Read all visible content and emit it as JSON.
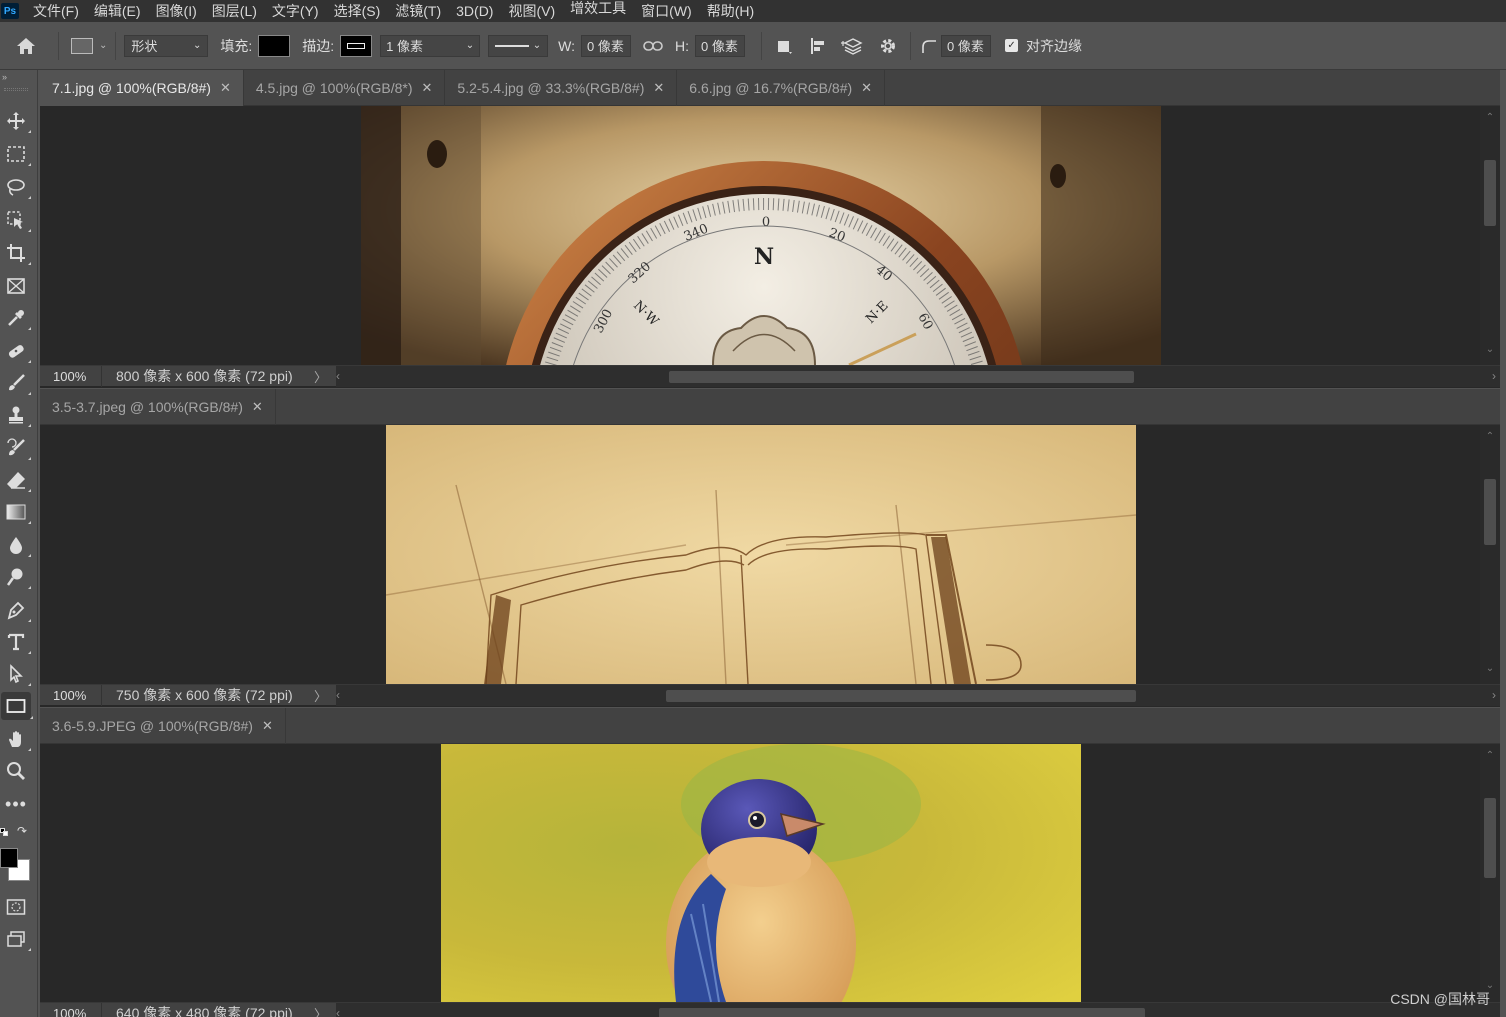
{
  "app": {
    "logo": "Ps"
  },
  "menu": [
    "文件(F)",
    "编辑(E)",
    "图像(I)",
    "图层(L)",
    "文字(Y)",
    "选择(S)",
    "滤镜(T)",
    "3D(D)",
    "视图(V)",
    "增效工具",
    "窗口(W)",
    "帮助(H)"
  ],
  "options": {
    "mode": "形状",
    "fill_label": "填充:",
    "stroke_label": "描边:",
    "stroke_width": "1 像素",
    "w_label": "W:",
    "w_value": "0 像素",
    "h_label": "H:",
    "h_value": "0 像素",
    "radius_value": "0 像素",
    "align_edges_label": "对齐边缘",
    "align_edges_checked": true
  },
  "tools": [
    "move-tool-icon",
    "marquee-tool-icon",
    "lasso-tool-icon",
    "object-select-tool-icon",
    "crop-tool-icon",
    "frame-tool-icon",
    "eyedropper-tool-icon",
    "healing-brush-icon",
    "brush-tool-icon",
    "stamp-tool-icon",
    "history-brush-icon",
    "eraser-tool-icon",
    "gradient-tool-icon",
    "blur-tool-icon",
    "dodge-tool-icon",
    "pen-tool-icon",
    "type-tool-icon",
    "path-select-tool-icon",
    "rectangle-tool-icon",
    "hand-tool-icon",
    "zoom-tool-icon",
    "more-tools-icon"
  ],
  "doc1": {
    "tabs": [
      {
        "label": "7.1.jpg @ 100%(RGB/8#)",
        "active": true
      },
      {
        "label": "4.5.jpg @ 100%(RGB/8*)",
        "active": false
      },
      {
        "label": "5.2-5.4.jpg @ 33.3%(RGB/8#)",
        "active": false
      },
      {
        "label": "6.6.jpg @ 16.7%(RGB/8#)",
        "active": false
      }
    ],
    "zoom": "100%",
    "info": "800 像素 x 600 像素 (72 ppi)",
    "compass_marks": [
      "0",
      "20",
      "340",
      "40",
      "320",
      "N",
      "N·W",
      "N·E",
      "300",
      "60"
    ]
  },
  "doc2": {
    "tabs": [
      {
        "label": "3.5-3.7.jpeg @ 100%(RGB/8#)",
        "active": true
      }
    ],
    "zoom": "100%",
    "info": "750 像素 x 600 像素 (72 ppi)"
  },
  "doc3": {
    "tabs": [
      {
        "label": "3.6-5.9.JPEG @ 100%(RGB/8#)",
        "active": true
      }
    ],
    "zoom": "100%",
    "info": "640 像素 x 480 像素 (72 ppi)"
  },
  "watermark": "CSDN @国林哥",
  "colors": {
    "foreground": "#000000",
    "background": "#ffffff"
  }
}
